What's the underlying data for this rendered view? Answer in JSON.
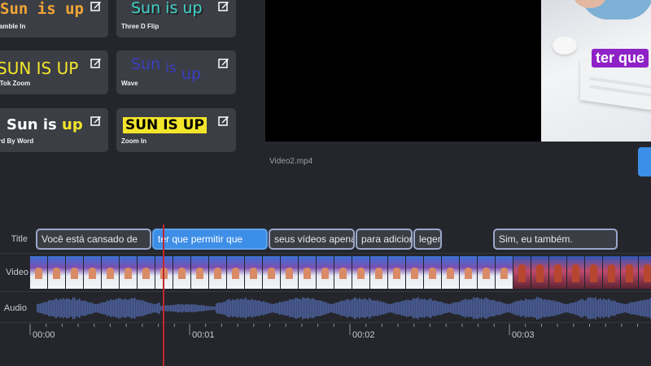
{
  "style_cards": [
    {
      "preview": "Sun is up",
      "name": "Scramble In"
    },
    {
      "preview": "Sun is up",
      "name": "Three D Flip"
    },
    {
      "preview": "SUN IS UP",
      "name": "Tik Tok Zoom"
    },
    {
      "preview_parts": [
        "Sun",
        "is",
        "up"
      ],
      "name": "Wave"
    },
    {
      "preview_parts": [
        "Sun is ",
        "up"
      ],
      "name": "Word By Word"
    },
    {
      "preview": "SUN IS UP",
      "name": "Zoom In"
    }
  ],
  "preview": {
    "file_name": "Video2.mp4",
    "webcam_caption": "ter que"
  },
  "timeline": {
    "tracks": {
      "title": "Title",
      "video": "Video",
      "audio": "Audio"
    },
    "title_clips": [
      "Você está cansado de",
      "ter que permitir que",
      "seus vídeos apena",
      "para adicior",
      "leger",
      "Sim, eu também."
    ],
    "selected_clip_index": 1,
    "ruler": [
      "00:00",
      "00:01",
      "00:02",
      "00:03"
    ]
  },
  "colors": {
    "accent": "#3d8ee6",
    "playhead": "#c0282d",
    "background": "#24262b",
    "card": "#3b3e45",
    "wave": "#4b5f9a"
  }
}
